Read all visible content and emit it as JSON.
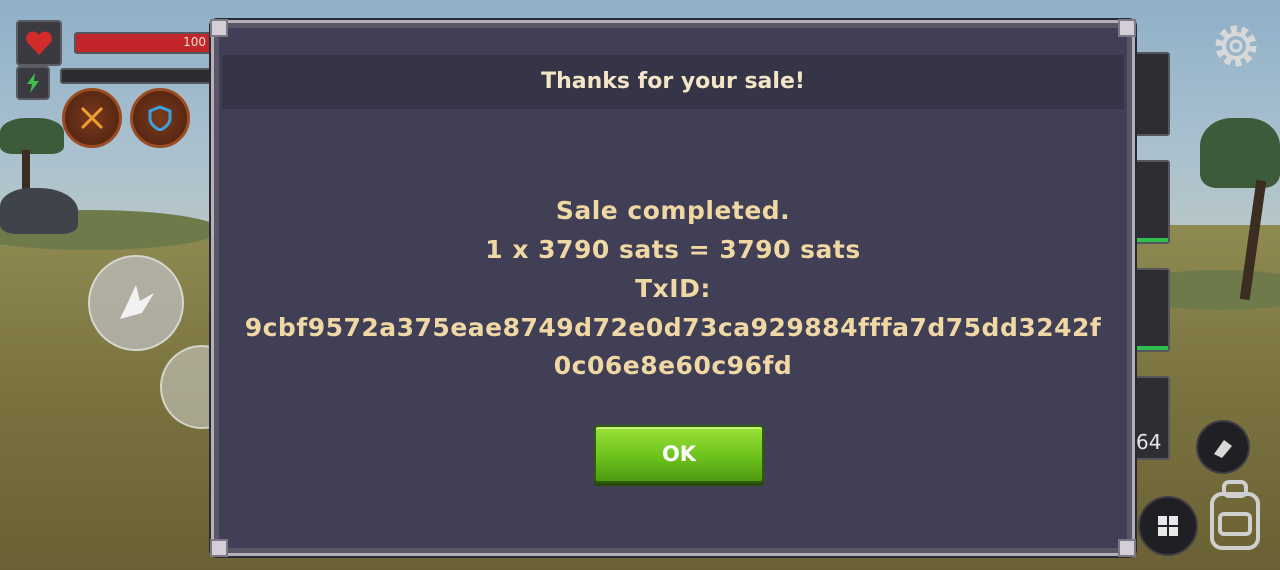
{
  "hud": {
    "health_value": "100",
    "health_fraction": 1.0,
    "health_color": "#c2262a",
    "inventory_count": "64",
    "icons": [
      "heart-icon",
      "energy-icon",
      "crossed-swords-icon",
      "shield-icon",
      "settings-gear-icon",
      "build-menu-icon",
      "backpack-icon"
    ]
  },
  "dialog": {
    "title": "Thanks for your sale!",
    "line1": "Sale completed.",
    "line2": "1 x 3790 sats = 3790 sats",
    "line3": "TxID:",
    "line4": "9cbf9572a375eae8749d72e0d73ca929884fffa7d75dd3242f",
    "line5": "0c06e8e60c96fd",
    "ok_label": "OK",
    "accent_text_color": "#f0d8a5",
    "button_color": "#6cc21c"
  }
}
